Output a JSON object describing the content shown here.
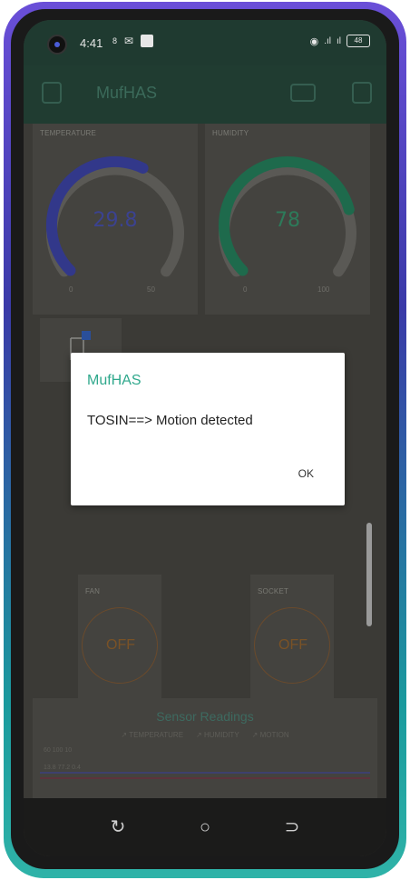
{
  "status_bar": {
    "time": "4:41",
    "indicator": "8",
    "battery": "48"
  },
  "app": {
    "title": "MufHAS"
  },
  "gauges": [
    {
      "label": "TEMPERATURE",
      "value": "29.8",
      "min": "0",
      "max": "50",
      "level": 0.596,
      "color": "#32388a",
      "text_color": "#3b4290"
    },
    {
      "label": "HUMIDITY",
      "value": "78",
      "min": "0",
      "max": "100",
      "level": 0.78,
      "color": "#1e6a4c",
      "text_color": "#2d7a5a"
    }
  ],
  "buttons": [
    {
      "label": "FAN",
      "state": "OFF"
    },
    {
      "label": "SOCKET",
      "state": "OFF"
    }
  ],
  "chart": {
    "title": "Sensor Readings",
    "legend": [
      "TEMPERATURE",
      "HUMIDITY",
      "MOTION"
    ],
    "y_ticks": [
      "60  100  10"
    ],
    "y_ticks_2": [
      "13.8  77.2  0.4"
    ]
  },
  "dialog": {
    "title": "MufHAS",
    "message": "TOSIN==> Motion detected",
    "ok_label": "OK"
  },
  "navigation": {
    "recent_icon": "recent-apps-icon",
    "home_icon": "home-icon",
    "back_icon": "back-icon"
  },
  "colors": {
    "app_bar": "#203c31",
    "accent": "#2fa88c",
    "button_outline": "#6a4a2c"
  }
}
